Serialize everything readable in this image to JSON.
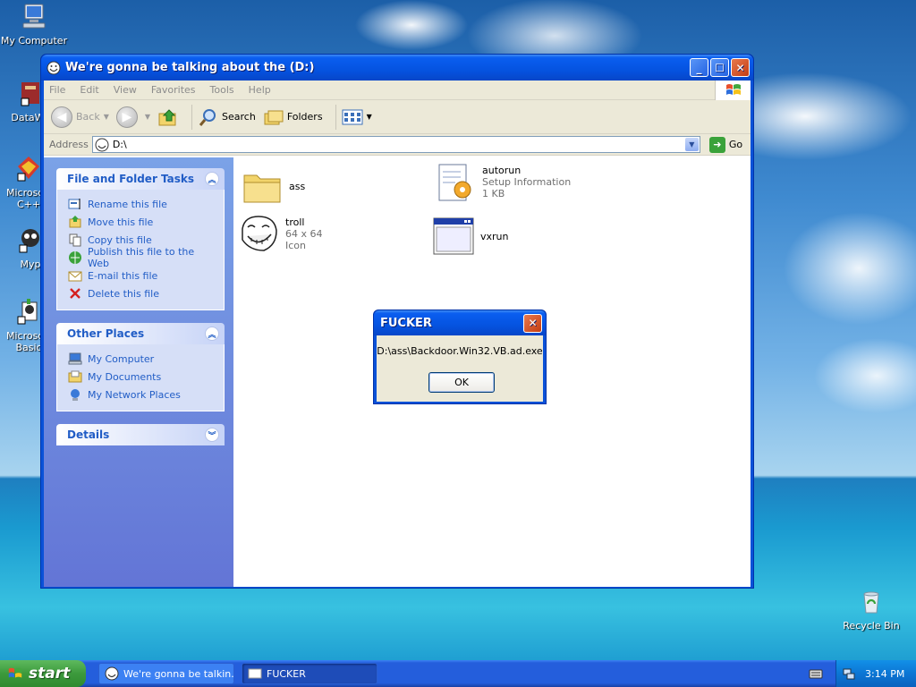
{
  "desktop": {
    "icons": [
      {
        "label": "My Computer"
      },
      {
        "label": "DataWa"
      },
      {
        "label": "Microsoft C++"
      },
      {
        "label": "Myp"
      },
      {
        "label": "Microsoft Basic"
      },
      {
        "label": "Recycle Bin"
      }
    ]
  },
  "window": {
    "title": "We're gonna be talking about the (D:)",
    "menu": [
      "File",
      "Edit",
      "View",
      "Favorites",
      "Tools",
      "Help"
    ],
    "toolbar": {
      "back": "Back",
      "search": "Search",
      "folders": "Folders"
    },
    "address": {
      "label": "Address",
      "value": "D:\\",
      "go": "Go"
    },
    "tasks": {
      "file_folder": {
        "title": "File and Folder Tasks",
        "items": [
          {
            "label": "Rename this file",
            "icon": "rename-icon"
          },
          {
            "label": "Move this file",
            "icon": "move-icon"
          },
          {
            "label": "Copy this file",
            "icon": "copy-icon"
          },
          {
            "label": "Publish this file to the Web",
            "icon": "publish-icon"
          },
          {
            "label": "E-mail this file",
            "icon": "email-icon"
          },
          {
            "label": "Delete this file",
            "icon": "delete-icon"
          }
        ]
      },
      "other_places": {
        "title": "Other Places",
        "items": [
          {
            "label": "My Computer",
            "icon": "computer-icon"
          },
          {
            "label": "My Documents",
            "icon": "documents-icon"
          },
          {
            "label": "My Network Places",
            "icon": "network-icon"
          }
        ]
      },
      "details": {
        "title": "Details"
      }
    },
    "files": [
      {
        "name": "ass",
        "meta": [],
        "icon": "folder-icon"
      },
      {
        "name": "autorun",
        "meta": [
          "Setup Information",
          "1 KB"
        ],
        "icon": "setup-info-icon"
      },
      {
        "name": "troll",
        "meta": [
          "64 x 64",
          "Icon"
        ],
        "icon": "trollface-icon"
      },
      {
        "name": "vxrun",
        "meta": [],
        "icon": "program-icon"
      }
    ]
  },
  "dialog": {
    "title": "FUCKER",
    "message": "D:\\ass\\Backdoor.Win32.VB.ad.exe",
    "ok": "OK"
  },
  "taskbar": {
    "start": "start",
    "buttons": [
      {
        "label": "We're gonna be talkin..."
      },
      {
        "label": "FUCKER"
      }
    ],
    "clock": "3:14 PM"
  },
  "colors": {
    "xp_blue": "#0a52d8",
    "task_link": "#215dc6",
    "start_green": "#3c9a3c"
  }
}
